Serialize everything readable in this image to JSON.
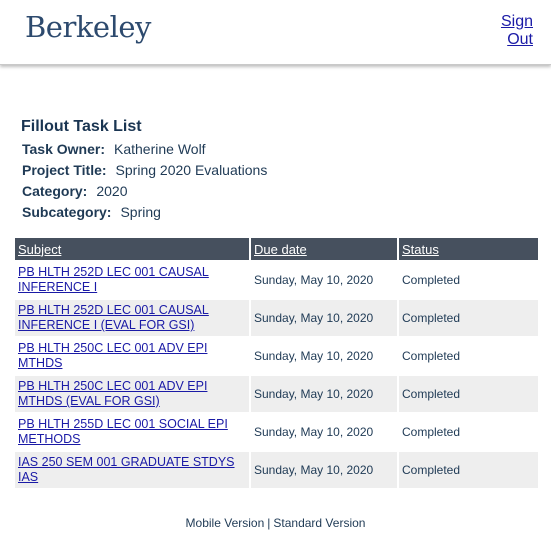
{
  "header": {
    "logo_text": "Berkeley",
    "signout_line1": "Sign",
    "signout_line2": "Out"
  },
  "page": {
    "title": "Fillout Task List",
    "meta": [
      {
        "label": "Task Owner:",
        "value": "Katherine Wolf"
      },
      {
        "label": "Project Title:",
        "value": "Spring 2020 Evaluations"
      },
      {
        "label": "Category:",
        "value": "2020"
      },
      {
        "label": "Subcategory:",
        "value": "Spring"
      }
    ]
  },
  "table": {
    "columns": [
      "Subject",
      "Due date",
      "Status"
    ],
    "rows": [
      {
        "subject": "PB HLTH 252D LEC 001 CAUSAL INFERENCE I",
        "due": "Sunday, May 10, 2020",
        "status": "Completed"
      },
      {
        "subject": "PB HLTH 252D LEC 001 CAUSAL INFERENCE I (EVAL FOR GSI)",
        "due": "Sunday, May 10, 2020",
        "status": "Completed"
      },
      {
        "subject": "PB HLTH 250C LEC 001 ADV EPI MTHDS",
        "due": "Sunday, May 10, 2020",
        "status": "Completed"
      },
      {
        "subject": "PB HLTH 250C LEC 001 ADV EPI MTHDS (EVAL FOR GSI)",
        "due": "Sunday, May 10, 2020",
        "status": "Completed"
      },
      {
        "subject": "PB HLTH 255D LEC 001 SOCIAL EPI METHODS",
        "due": "Sunday, May 10, 2020",
        "status": "Completed"
      },
      {
        "subject": "IAS 250 SEM 001 GRADUATE STDYS IAS",
        "due": "Sunday, May 10, 2020",
        "status": "Completed"
      }
    ]
  },
  "footer": {
    "mobile_label": "Mobile Version",
    "separator": "|",
    "standard_label": "Standard Version"
  },
  "colors": {
    "header_bar": "#46505e",
    "link": "#1a1aa6",
    "logo": "#2d4a6e",
    "row_alt": "#eeeeee"
  }
}
